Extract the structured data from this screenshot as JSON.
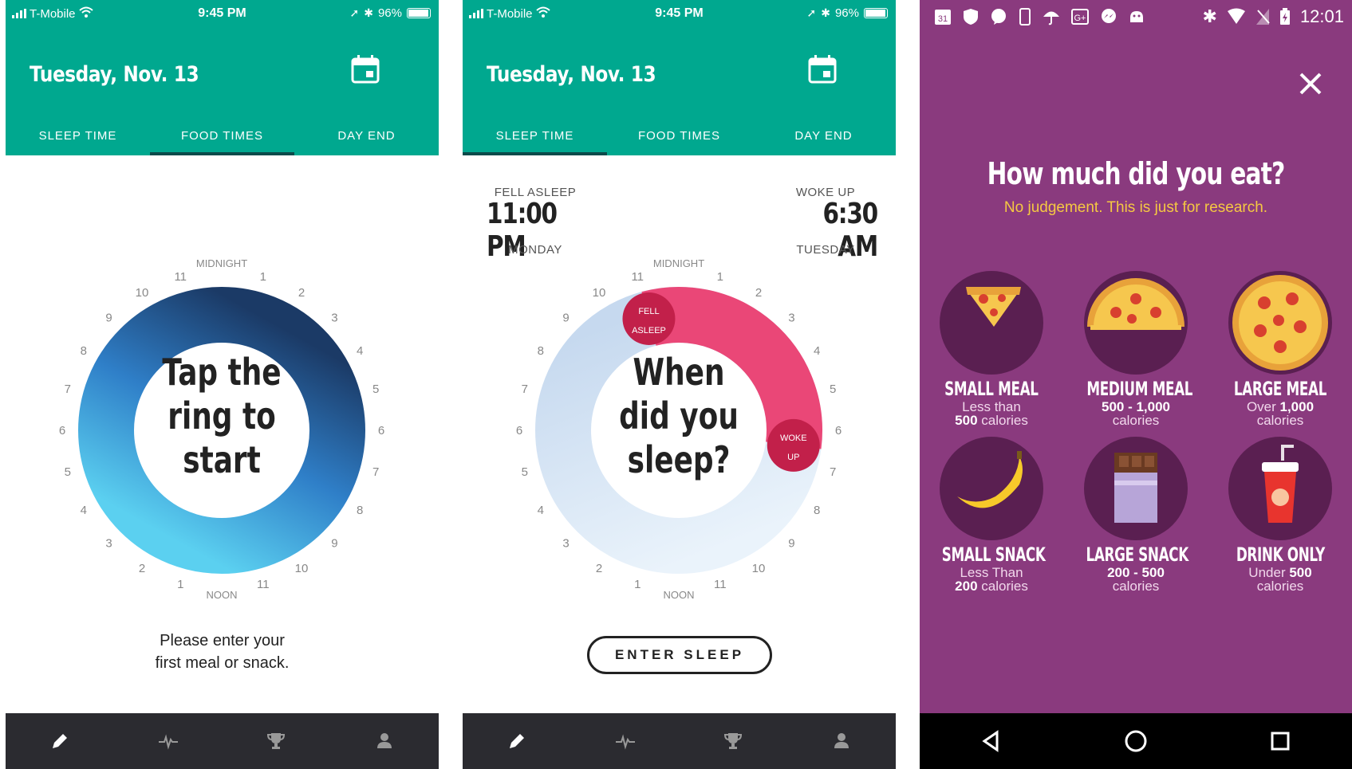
{
  "screen1": {
    "status": {
      "carrier": "T-Mobile",
      "time": "9:45 PM",
      "battery": "96%"
    },
    "date_title": "Tuesday, Nov. 13",
    "tabs": [
      {
        "label": "SLEEP TIME"
      },
      {
        "label": "FOOD TIMES"
      },
      {
        "label": "DAY END"
      }
    ],
    "active_tab": "FOOD TIMES",
    "clock": {
      "top_label": "MIDNIGHT",
      "bottom_label": "NOON"
    },
    "ring_text": [
      "Tap the",
      "ring to",
      "start"
    ],
    "prompt": [
      "Please enter your",
      "first meal or snack."
    ],
    "nav_icons": [
      "pencil-icon",
      "pulse-icon",
      "trophy-icon",
      "person-icon"
    ]
  },
  "screen2": {
    "status": {
      "carrier": "T-Mobile",
      "time": "9:45 PM",
      "battery": "96%"
    },
    "date_title": "Tuesday, Nov. 13",
    "tabs": [
      {
        "label": "SLEEP TIME"
      },
      {
        "label": "FOOD TIMES"
      },
      {
        "label": "DAY END"
      }
    ],
    "active_tab": "SLEEP TIME",
    "fell_asleep": {
      "label": "FELL ASLEEP",
      "time": "11:00 PM",
      "day": "MONDAY"
    },
    "woke_up": {
      "label": "WOKE UP",
      "time": "6:30 AM",
      "day": "TUESDAY"
    },
    "clock": {
      "top_label": "MIDNIGHT",
      "bottom_label": "NOON"
    },
    "handle_fell": [
      "FELL",
      "ASLEEP"
    ],
    "handle_woke": [
      "WOKE",
      "UP"
    ],
    "ring_text": [
      "When",
      "did you",
      "sleep?"
    ],
    "button": "ENTER SLEEP",
    "nav_icons": [
      "pencil-icon",
      "pulse-icon",
      "trophy-icon",
      "person-icon"
    ]
  },
  "screen3": {
    "status_time": "12:01",
    "title": "How much did you eat?",
    "subtitle": "No judgement. This is just for research.",
    "meals": [
      {
        "name": "SMALL MEAL",
        "line1_text": "Less than",
        "line1_bold": "",
        "line2_bold": "500",
        "line2_text": " calories",
        "icon": "pizza-slice-icon"
      },
      {
        "name": "MEDIUM MEAL",
        "line1_text": "",
        "line1_bold": "500 - 1,000",
        "line2_bold": "",
        "line2_text": "calories",
        "icon": "half-pizza-icon"
      },
      {
        "name": "LARGE MEAL",
        "line1_text": "Over ",
        "line1_bold": "1,000",
        "line2_bold": "",
        "line2_text": "calories",
        "icon": "whole-pizza-icon"
      },
      {
        "name": "SMALL SNACK",
        "line1_text": "Less Than",
        "line1_bold": "",
        "line2_bold": "200",
        "line2_text": " calories",
        "icon": "banana-icon"
      },
      {
        "name": "LARGE SNACK",
        "line1_text": "",
        "line1_bold": "200 - 500",
        "line2_bold": "",
        "line2_text": "calories",
        "icon": "chocolate-bar-icon"
      },
      {
        "name": "DRINK ONLY",
        "line1_text": "Under ",
        "line1_bold": "500",
        "line2_bold": "",
        "line2_text": "calories",
        "icon": "soda-cup-icon"
      }
    ],
    "nav_icons": [
      "back-icon",
      "home-icon",
      "recents-icon"
    ]
  },
  "colors": {
    "teal": "#00a88f",
    "tab_indicator": "#0c4a4a",
    "ring_dark": "#1b3a66",
    "ring_light": "#5bd0f0",
    "sleep_arc": "#ea4777",
    "handle": "#c2204a",
    "purple_bg": "#8a3a7e",
    "disc": "#5a1f51",
    "subtitle_yellow": "#f5c842",
    "nav_dark": "#2b2b30"
  }
}
